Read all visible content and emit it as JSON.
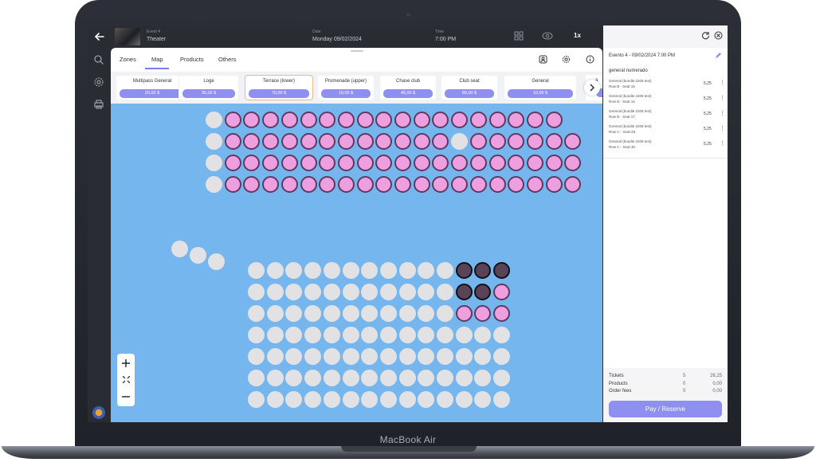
{
  "device": {
    "brand_label": "MacBook Air"
  },
  "topbar": {
    "event_label": "Event 4",
    "event_value": "Theater",
    "date_label": "Date",
    "date_value": "Monday 09/02/2024",
    "time_label": "Time",
    "time_value": "7:00 PM",
    "zoom_value": "1x"
  },
  "tabs": [
    {
      "label": "Zones",
      "active": false
    },
    {
      "label": "Map",
      "active": true
    },
    {
      "label": "Products",
      "active": false
    },
    {
      "label": "Others",
      "active": false
    }
  ],
  "zones": [
    {
      "name": "Multipass General",
      "price": "20,00 $",
      "selected": false
    },
    {
      "name": "Loge",
      "price": "35,00 $",
      "selected": false
    },
    {
      "name": "Terrace (lower)",
      "price": "70,00 $",
      "selected": true
    },
    {
      "name": "Promenade (upper)",
      "price": "10,00 $",
      "selected": false
    },
    {
      "name": "Chase club",
      "price": "45,00 $",
      "selected": false
    },
    {
      "name": "Club seat",
      "price": "80,00 $",
      "selected": false
    },
    {
      "name": "General",
      "price": "10,00 $",
      "selected": false
    }
  ],
  "zone_partial_name": "a",
  "seat_blocks": {
    "upper": {
      "rows": [
        "uffffffffffffffffff",
        "uffffffffffffuffffff",
        "ufffffffffffffffffff",
        "ufffffffffffffffffff"
      ]
    },
    "side": {
      "count": 3
    },
    "lower": {
      "rows": [
        "uuuuuuuuuuusss",
        "uuuuuuuuuuussf",
        "uuuuuuuuuuufff",
        "uuuuuuuuuuuuuu",
        "uuuuuuuuuuuuuu",
        "uuuuuuuuuuuuuu",
        "uuuuuuuuuuuuuu"
      ]
    },
    "legend": {
      "f": "available",
      "u": "unavailable",
      "s": "selected"
    }
  },
  "colors": {
    "map_background": "#76b6ee",
    "seat_available": "#ee9fdf",
    "seat_unavailable": "#e2e2e4",
    "seat_selected": "#5a4258",
    "accent": "#8f8ff2"
  },
  "cart": {
    "event_line": "Evento 4 - 09/02/2024 7:00 PM",
    "zone_name": "general numerado",
    "items": [
      {
        "title": "General (bundle 2208 test)",
        "seat": "Row B - Seat 15",
        "price": "5,25"
      },
      {
        "title": "General (bundle 2208 test)",
        "seat": "Row B - Seat 16",
        "price": "5,25"
      },
      {
        "title": "General (bundle 2208 test)",
        "seat": "Row B - Seat 17",
        "price": "5,25"
      },
      {
        "title": "General (bundle 2208 test)",
        "seat": "Row C - Seat 29",
        "price": "5,25"
      },
      {
        "title": "General (bundle 2208 test)",
        "seat": "Row C - Seat 30",
        "price": "5,25"
      }
    ],
    "summary": [
      {
        "label": "Tickets",
        "qty": "5",
        "amount": "26,25"
      },
      {
        "label": "Products",
        "qty": "0",
        "amount": "0,00"
      },
      {
        "label": "Order fees",
        "qty": "0",
        "amount": "0,00"
      }
    ],
    "pay_button": "Pay / Reserve"
  }
}
